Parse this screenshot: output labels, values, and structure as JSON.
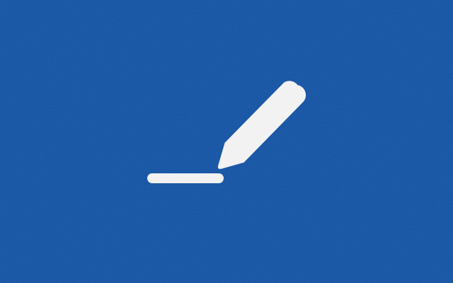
{
  "background": {
    "color": "#0d4ea1"
  },
  "illustration": {
    "icon": "edit-pencil-icon",
    "color": "#f2f2f2"
  }
}
